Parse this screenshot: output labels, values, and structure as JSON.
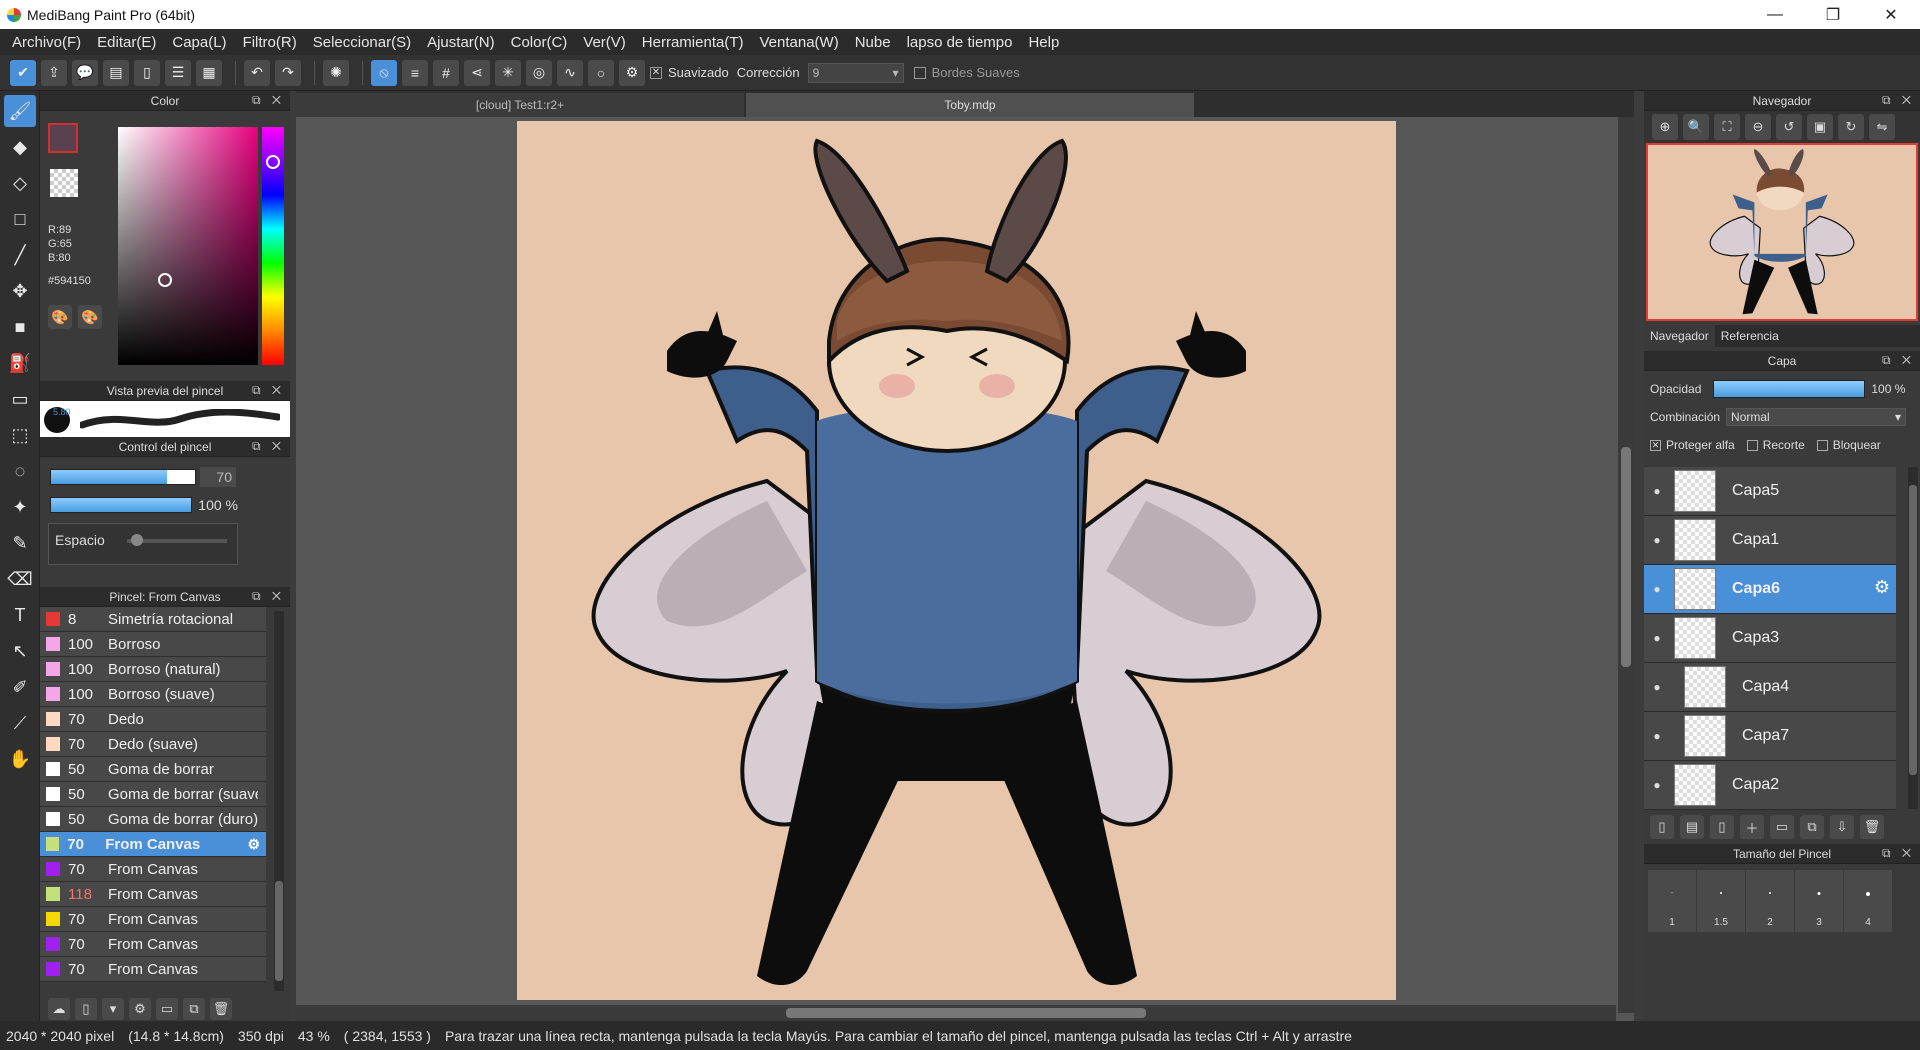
{
  "window": {
    "title": "MediBang Paint Pro (64bit)",
    "minimize": "—",
    "maximize": "❐",
    "close": "✕"
  },
  "menu": [
    "Archivo(F)",
    "Editar(E)",
    "Capa(L)",
    "Filtro(R)",
    "Seleccionar(S)",
    "Ajustar(N)",
    "Color(C)",
    "Ver(V)",
    "Herramienta(T)",
    "Ventana(W)",
    "Nube",
    "lapso de tiempo",
    "Help"
  ],
  "toolbar": {
    "smoothing_label": "Suavizado",
    "correction_label": "Corrección",
    "correction_value": "9",
    "soft_edges_label": "Bordes Suaves"
  },
  "color_panel": {
    "title": "Color",
    "r": "R:89",
    "g": "G:65",
    "b": "B:80",
    "hex": "#594150",
    "fg_color": "#594150"
  },
  "brush_preview": {
    "title": "Vista previa del pincel",
    "size_text": "5.80"
  },
  "brush_control": {
    "title": "Control del pincel",
    "size_value": "70",
    "opacity_value": "100 %",
    "spacing_label": "Espacio"
  },
  "brush_list": {
    "title": "Pincel: From Canvas",
    "items": [
      {
        "color": "#e53935",
        "size": "8",
        "name": "Simetría rotacional"
      },
      {
        "color": "#f4a6e8",
        "size": "100",
        "name": "Borroso"
      },
      {
        "color": "#f4a6e8",
        "size": "100",
        "name": "Borroso (natural)"
      },
      {
        "color": "#f4a6e8",
        "size": "100",
        "name": "Borroso (suave)"
      },
      {
        "color": "#ffd9c0",
        "size": "70",
        "name": "Dedo"
      },
      {
        "color": "#ffd9c0",
        "size": "70",
        "name": "Dedo (suave)"
      },
      {
        "color": "#ffffff",
        "size": "50",
        "name": "Goma de borrar"
      },
      {
        "color": "#ffffff",
        "size": "50",
        "name": "Goma de borrar (suave)"
      },
      {
        "color": "#ffffff",
        "size": "50",
        "name": "Goma de borrar (duro)"
      },
      {
        "color": "#c5e07a",
        "size": "70",
        "name": "From Canvas"
      },
      {
        "color": "#a020f0",
        "size": "70",
        "name": "From Canvas"
      },
      {
        "color": "#c5e07a",
        "size": "118",
        "name": "From Canvas"
      },
      {
        "color": "#f5d800",
        "size": "70",
        "name": "From Canvas"
      },
      {
        "color": "#a020f0",
        "size": "70",
        "name": "From Canvas"
      },
      {
        "color": "#a020f0",
        "size": "70",
        "name": "From Canvas"
      }
    ]
  },
  "tabs": [
    "[cloud] Test1:r2+",
    "Toby.mdp"
  ],
  "navigator": {
    "title": "Navegador",
    "tab_nav": "Navegador",
    "tab_ref": "Referencia"
  },
  "layer_panel": {
    "title": "Capa",
    "opacity_label": "Opacidad",
    "opacity_value": "100 %",
    "blend_label": "Combinación",
    "blend_value": "Normal",
    "protect_alpha": "Proteger alfa",
    "clipping": "Recorte",
    "lock": "Bloquear",
    "layers": [
      {
        "name": "Capa5"
      },
      {
        "name": "Capa1"
      },
      {
        "name": "Capa6"
      },
      {
        "name": "Capa3"
      },
      {
        "name": "Capa4"
      },
      {
        "name": "Capa7"
      },
      {
        "name": "Capa2"
      }
    ]
  },
  "brush_size_panel": {
    "title": "Tamaño del Pincel",
    "sizes": [
      "1",
      "1.5",
      "2",
      "3",
      "4"
    ]
  },
  "status": {
    "canvas_size": "2040 * 2040 pixel",
    "physical_size": "(14.8 * 14.8cm)",
    "dpi": "350 dpi",
    "zoom": "43 %",
    "coords": "( 2384, 1553 )",
    "hint": "Para trazar una línea recta, mantenga pulsada la tecla Mayús. Para cambiar el tamaño del pincel, mantenga pulsada las teclas Ctrl + Alt y arrastre"
  }
}
